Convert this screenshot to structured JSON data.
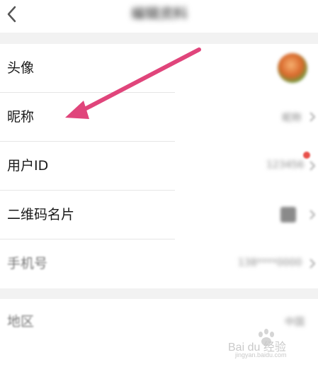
{
  "header": {
    "title": "编辑资料"
  },
  "rows": [
    {
      "label": "头像"
    },
    {
      "label": "昵称",
      "value": "昵称"
    },
    {
      "label": "用户ID",
      "value": "123456"
    },
    {
      "label": "二维码名片"
    },
    {
      "label": "手机号",
      "value": "138****0000"
    }
  ],
  "section2": {
    "row1_label": "地区",
    "row1_value": "中国"
  },
  "watermark": {
    "brand": "Bai du 经验",
    "url": "jingyan.baidu.com"
  },
  "colors": {
    "arrow": "#e0457b",
    "accent": "#e8504a"
  },
  "icons": {
    "back": "chevron-left-icon",
    "row_arrow": "chevron-right-icon"
  }
}
